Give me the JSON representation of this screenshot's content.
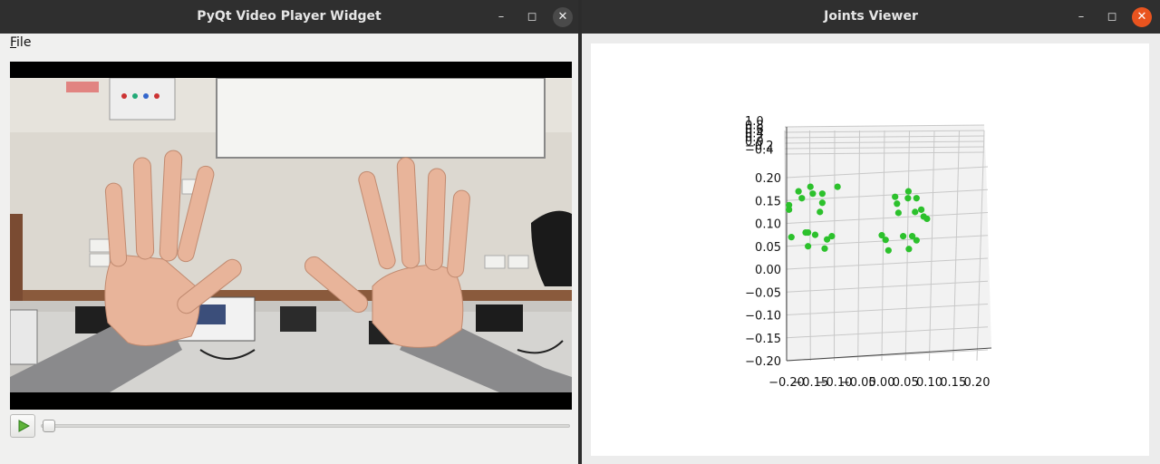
{
  "left_window": {
    "title": "PyQt Video Player Widget",
    "controls": {
      "minimize": "–",
      "maximize": "◻",
      "close": "✕"
    },
    "menu": {
      "file_label": "ile",
      "file_mnemonic": "F"
    },
    "player": {
      "play_icon": "play-icon",
      "position_fraction": 0.0
    }
  },
  "right_window": {
    "title": "Joints Viewer",
    "controls": {
      "minimize": "–",
      "maximize": "◻",
      "close": "✕"
    }
  },
  "chart_data": {
    "type": "scatter",
    "projection": "3d",
    "title": "",
    "xlabel": "",
    "ylabel": "",
    "zlabel": "",
    "grid": true,
    "marker_color": "#2cc12c",
    "x_ticks": [
      "−0.20",
      "−0.15",
      "−0.10",
      "−0.05",
      "0.00",
      "0.05",
      "0.10",
      "0.15",
      "0.20"
    ],
    "y_ticks": [
      "0.20",
      "0.15",
      "0.10",
      "0.05",
      "0.00",
      "−0.05",
      "−0.10",
      "−0.15",
      "−0.20"
    ],
    "z_ticks": [
      "1.0",
      "0.8",
      "0.6",
      "0.4",
      "0.2",
      "0.0",
      "−0.2",
      "−0.4"
    ],
    "xlim": [
      -0.2,
      0.2
    ],
    "ylim": [
      -0.2,
      0.2
    ],
    "series": [
      {
        "x": [
          -0.195,
          -0.195,
          -0.19,
          -0.175,
          -0.168,
          -0.16,
          -0.155,
          -0.155,
          -0.15,
          -0.145,
          -0.14,
          -0.13,
          -0.125,
          -0.125,
          -0.12,
          -0.115,
          -0.105,
          -0.093,
          0.0,
          0.008,
          0.014,
          0.028,
          0.032,
          0.035,
          0.045,
          0.055,
          0.056,
          0.057,
          0.064,
          0.07,
          0.073,
          0.073,
          0.083,
          0.088,
          0.095
        ],
        "y": [
          0.14,
          0.13,
          0.07,
          0.17,
          0.155,
          0.08,
          0.05,
          0.08,
          0.18,
          0.165,
          0.075,
          0.125,
          0.145,
          0.165,
          0.045,
          0.065,
          0.072,
          0.18,
          0.074,
          0.064,
          0.041,
          0.158,
          0.143,
          0.123,
          0.072,
          0.155,
          0.17,
          0.044,
          0.072,
          0.125,
          0.155,
          0.063,
          0.13,
          0.115,
          0.11
        ],
        "z": []
      }
    ]
  }
}
